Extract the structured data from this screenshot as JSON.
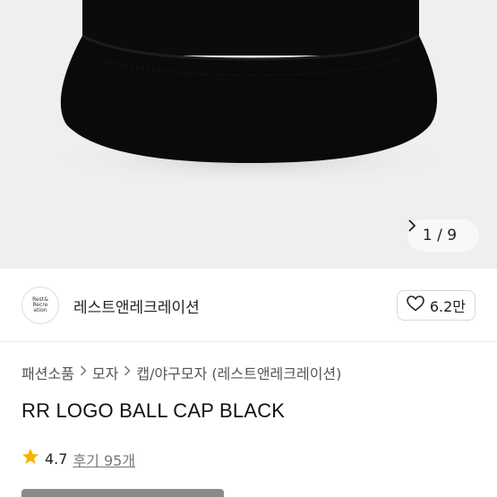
{
  "gallery": {
    "pager_text": "1 / 9",
    "next_icon": "chevron-right-icon"
  },
  "seller": {
    "logo_lines": [
      "Rest&",
      "Recre",
      "ation"
    ],
    "name": "레스트앤레크레이션",
    "like_icon": "heart-outline-icon",
    "like_count": "6.2만"
  },
  "breadcrumb": {
    "items": [
      "패션소품",
      "모자",
      "캡/야구모자 (레스트앤레크레이션)"
    ],
    "separator_icon": "chevron-right-icon"
  },
  "product": {
    "title": "RR LOGO BALL CAP BLACK"
  },
  "rating": {
    "star_icon": "star-icon",
    "star_color": "#f5b300",
    "score": "4.7",
    "reviews": "후기 95개"
  }
}
